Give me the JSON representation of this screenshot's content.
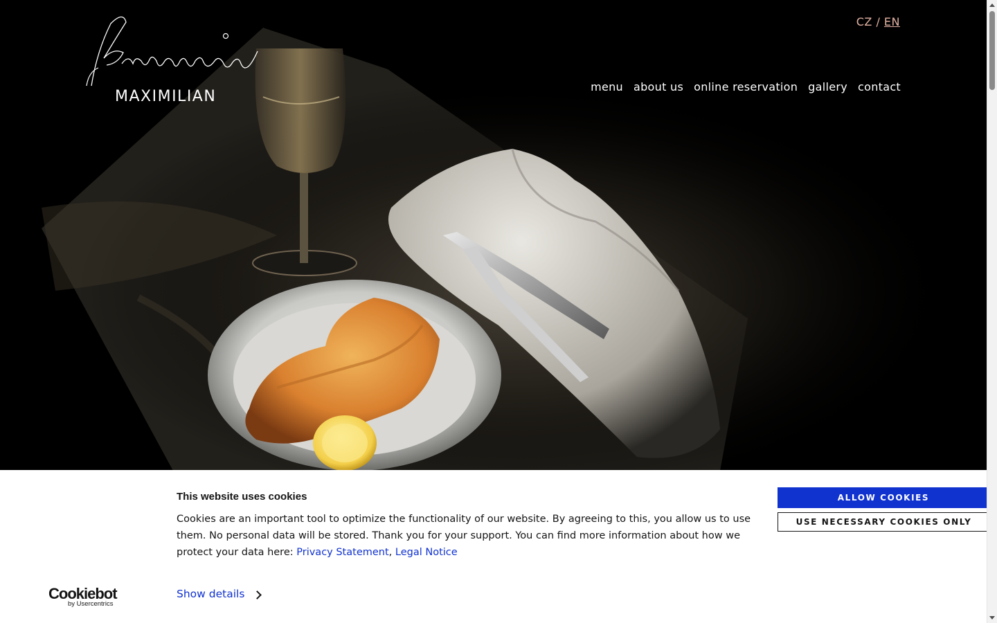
{
  "brand": {
    "script_word": "Brasserie",
    "name": "MAXIMILIAN"
  },
  "language": {
    "options": [
      "CZ",
      "EN"
    ],
    "separator": "/",
    "current": "EN"
  },
  "nav": {
    "items": [
      {
        "label": "menu"
      },
      {
        "label": "about us"
      },
      {
        "label": "online reservation"
      },
      {
        "label": "gallery"
      },
      {
        "label": "contact"
      }
    ]
  },
  "hero": {
    "image": "restaurant-table-schnitzel-wine-glass"
  },
  "cookie_banner": {
    "title": "This website uses cookies",
    "text": "Cookies are an important tool to optimize the functionality of our website. By agreeing to this, you allow us to use them. No personal data will be stored. Thank you for your support. You can find more information about how we protect your data here:",
    "link_privacy": "Privacy Statement",
    "link_separator": ",",
    "link_legal": "Legal Notice",
    "allow_button": "ALLOW COOKIES",
    "necessary_button": "USE NECESSARY COOKIES ONLY",
    "show_details": "Show details",
    "provider_name": "Cookiebot",
    "provider_by": "by Usercentrics"
  },
  "colors": {
    "background": "#000000",
    "language_accent": "#e3b3a3",
    "cookie_link": "#1032cf",
    "allow_button_bg": "#1032cf"
  },
  "icons": {
    "show_details": "chevron-right-icon",
    "scroll_up": "arrow-up-icon",
    "scroll_down": "arrow-down-icon"
  }
}
